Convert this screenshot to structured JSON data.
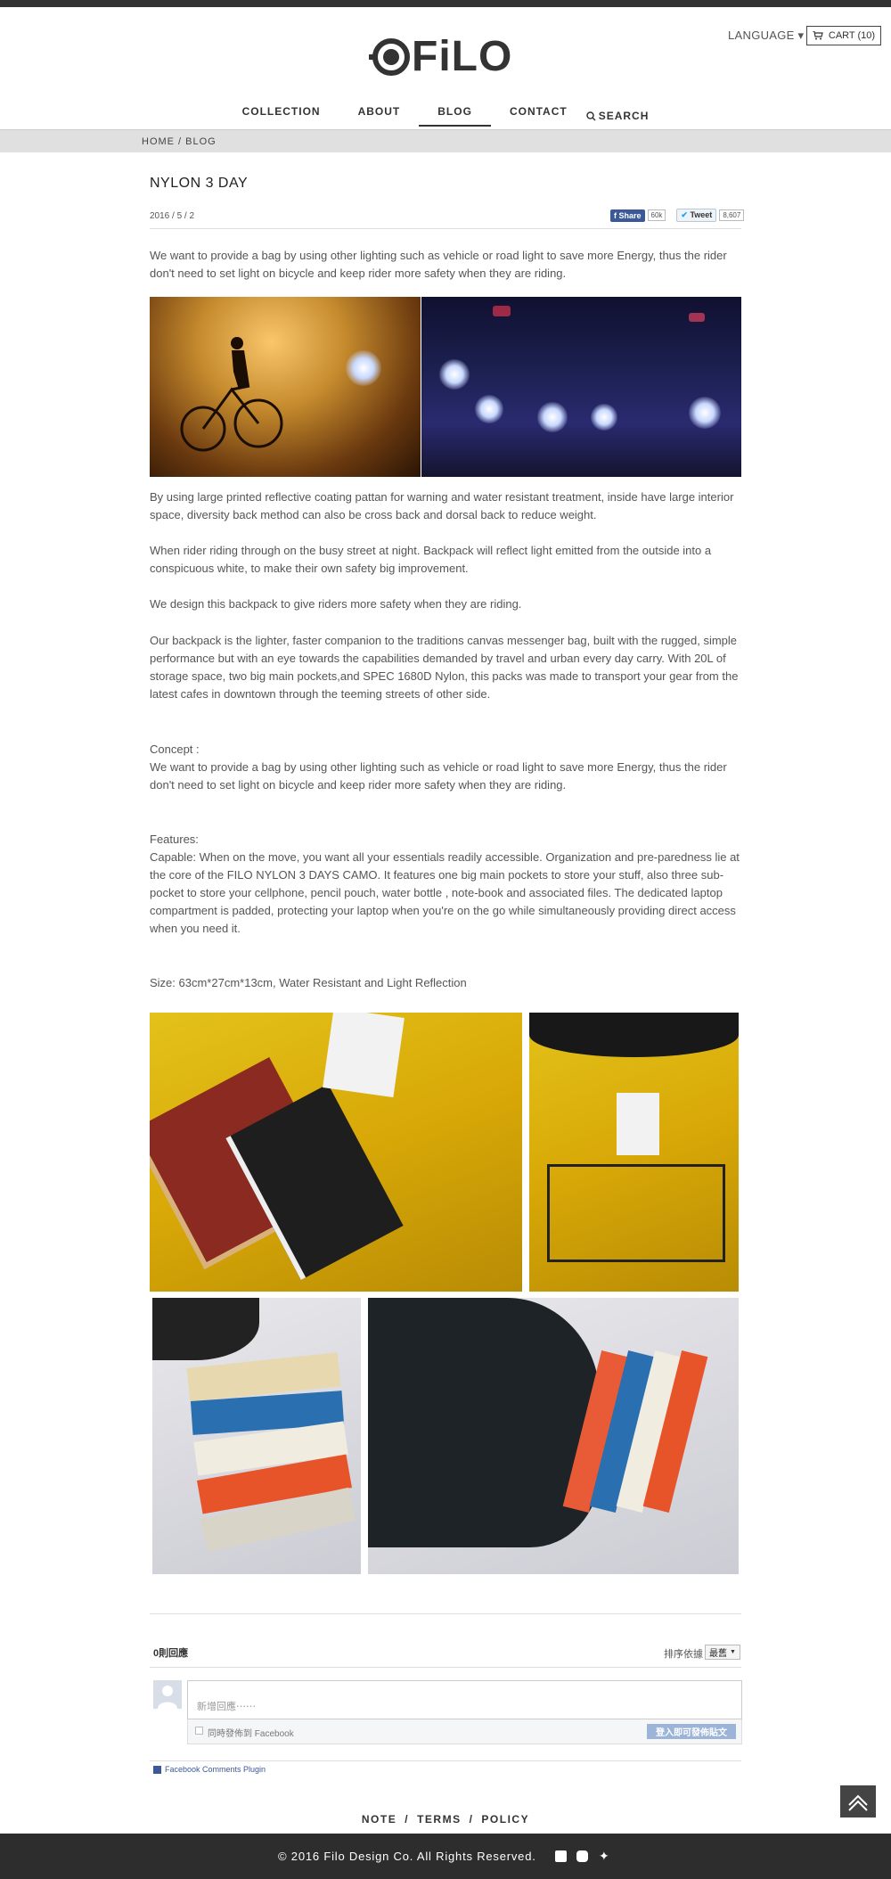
{
  "header": {
    "language_label": "LANGUAGE ▾",
    "cart_label": "CART (10)",
    "logo_text": "FiLO"
  },
  "nav": {
    "items": [
      "COLLECTION",
      "ABOUT",
      "BLOG",
      "CONTACT"
    ],
    "search_label": "SEARCH",
    "active": "BLOG"
  },
  "breadcrumb": "HOME / BLOG",
  "post": {
    "title": "NYLON 3 DAY",
    "date": "2016 / 5 / 2",
    "share_label": "Share",
    "share_count": "60k",
    "tweet_label": "Tweet",
    "tweet_count": "8,607",
    "intro": "We want to provide a bag by using other lighting such as vehicle or road light to save more Energy, thus the rider don't need to set light on bicycle and keep rider more safety when they are riding.",
    "p1": "By using large printed reflective coating pattan for warning and water resistant treatment, inside have large interior space, diversity back method can also be cross back and dorsal back to reduce weight.",
    "p2": "When rider riding through on the busy street at night. Backpack will reflect light emitted from the outside into a conspicuous white, to make their own safety big improvement.",
    "p3": "We design this backpack to give riders more safety when they are riding.",
    "p4": "Our backpack is the lighter, faster companion to the traditions canvas messenger bag, built with the rugged, simple performance but with an eye towards the capabilities demanded by travel and urban every day carry. With 20L of storage space, two big main pockets,and SPEC 1680D Nylon, this packs was made to transport your gear from the latest cafes in downtown through the teeming streets of other side.",
    "concept_label": "Concept :",
    "concept_text": "We want to provide a bag by using other lighting such as vehicle or road light to save more Energy, thus the rider don't need to set light on bicycle and keep rider more safety when they are riding.",
    "features_label": "Features:",
    "features_text": "Capable: When on the move, you want all your essentials readily accessible. Organization and pre-paredness lie at the core of the FILO NYLON 3 DAYS CAMO. It features one big main pockets to store your stuff, also three sub-pocket to store your  cellphone, pencil pouch, water bottle , note-book and associated files. The dedicated laptop compartment is padded, protecting your laptop when you're on the go while simultaneously providing direct access when you need it.",
    "size_text": "Size: 63cm*27cm*13cm, Water Resistant and Light Reflection"
  },
  "comments": {
    "count_label": "0則回應",
    "sort_label": "排序依據",
    "sort_value": "最舊",
    "placeholder": "新增回應⋯⋯",
    "also_post": "同時發佈到 Facebook",
    "login_button": "登入即可發佈貼文",
    "plugin_label": "Facebook Comments Plugin"
  },
  "footer": {
    "links": [
      "NOTE",
      "TERMS",
      "POLICY"
    ],
    "copyright": "© 2016 Filo Design Co. All Rights Reserved."
  },
  "colors": {
    "dark": "#2d2d2d",
    "facebook": "#3b5998"
  }
}
